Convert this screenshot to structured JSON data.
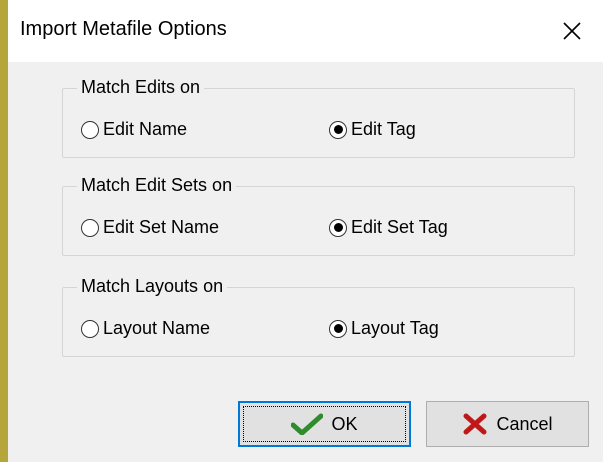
{
  "dialog": {
    "title": "Import Metafile Options"
  },
  "groups": [
    {
      "legend": "Match Edits on",
      "options": [
        {
          "label": "Edit Name",
          "selected": false
        },
        {
          "label": "Edit Tag",
          "selected": true
        }
      ]
    },
    {
      "legend": "Match Edit Sets on",
      "options": [
        {
          "label": "Edit Set Name",
          "selected": false
        },
        {
          "label": "Edit Set Tag",
          "selected": true
        }
      ]
    },
    {
      "legend": "Match Layouts on",
      "options": [
        {
          "label": "Layout Name",
          "selected": false
        },
        {
          "label": "Layout Tag",
          "selected": true
        }
      ]
    }
  ],
  "buttons": {
    "ok_label": "OK",
    "cancel_label": "Cancel"
  },
  "icons": {
    "ok": "checkmark-icon",
    "cancel": "x-icon",
    "close": "close-icon"
  },
  "colors": {
    "ok_icon": "#2e8b2e",
    "cancel_icon": "#c01818",
    "focus_border": "#0078d7",
    "background": "#b5a53a"
  }
}
